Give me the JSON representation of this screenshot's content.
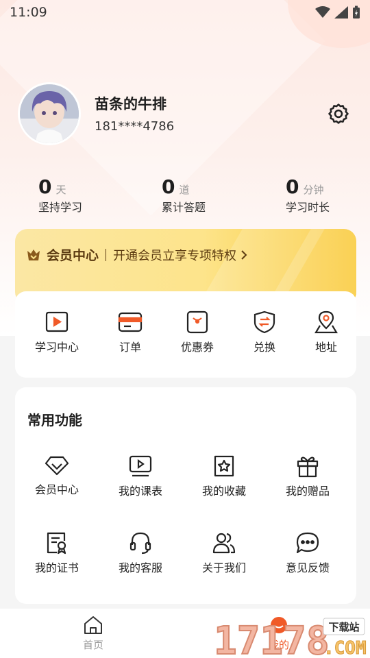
{
  "status_bar": {
    "time": "11:09"
  },
  "profile": {
    "name": "苗条的牛排",
    "phone": "181****4786"
  },
  "stats": [
    {
      "value": "0",
      "unit": "天",
      "label": "坚持学习"
    },
    {
      "value": "0",
      "unit": "道",
      "label": "累计答题"
    },
    {
      "value": "0",
      "unit": "分钟",
      "label": "学习时长"
    }
  ],
  "vip": {
    "title": "会员中心",
    "desc": "开通会员立享专项特权"
  },
  "quick_menu": [
    {
      "label": "学习中心",
      "icon": "video-play-icon"
    },
    {
      "label": "订单",
      "icon": "card-icon"
    },
    {
      "label": "优惠券",
      "icon": "coupon-icon"
    },
    {
      "label": "兑换",
      "icon": "exchange-shield-icon"
    },
    {
      "label": "地址",
      "icon": "location-icon"
    }
  ],
  "common": {
    "title": "常用功能",
    "items": [
      {
        "label": "会员中心",
        "icon": "diamond-icon"
      },
      {
        "label": "我的课表",
        "icon": "course-video-icon"
      },
      {
        "label": "我的收藏",
        "icon": "star-bookmark-icon"
      },
      {
        "label": "我的赠品",
        "icon": "gift-icon"
      },
      {
        "label": "我的证书",
        "icon": "certificate-icon"
      },
      {
        "label": "我的客服",
        "icon": "headset-icon"
      },
      {
        "label": "关于我们",
        "icon": "users-icon"
      },
      {
        "label": "意见反馈",
        "icon": "chat-icon"
      }
    ]
  },
  "nav": [
    {
      "label": "首页",
      "icon": "home-icon"
    },
    {
      "label": "我的",
      "icon": "profile-icon"
    }
  ],
  "watermark": {
    "text": "17178",
    "suffix": ".COM",
    "badge": "下载站"
  },
  "colors": {
    "accent": "#f05a28",
    "vip_text": "#5b3a10",
    "vip_gold": "#f9c72f"
  }
}
